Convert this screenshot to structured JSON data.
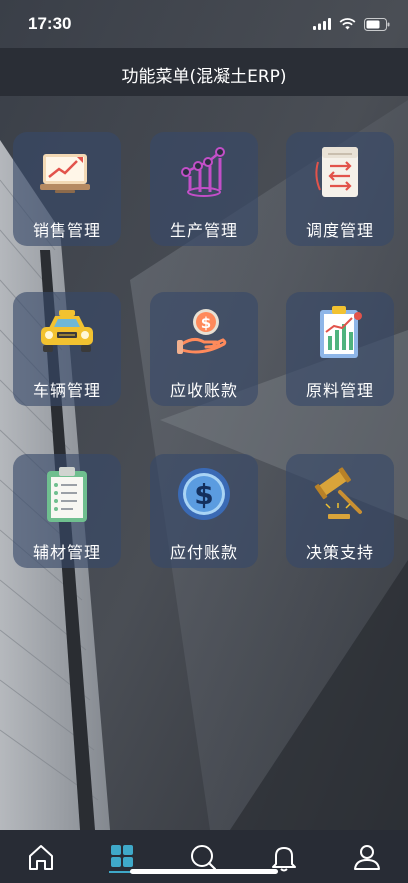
{
  "status_bar": {
    "time": "17:30",
    "icons": [
      "signal-icon",
      "wifi-icon",
      "battery-icon"
    ]
  },
  "header": {
    "title": "功能菜单(混凝土ERP)"
  },
  "menu": {
    "items": [
      {
        "label": "销售管理",
        "icon": "sales-chart-icon"
      },
      {
        "label": "生产管理",
        "icon": "production-graph-icon"
      },
      {
        "label": "调度管理",
        "icon": "dispatch-document-icon"
      },
      {
        "label": "车辆管理",
        "icon": "taxi-vehicle-icon"
      },
      {
        "label": "应收账款",
        "icon": "receivable-money-icon"
      },
      {
        "label": "原料管理",
        "icon": "material-clipboard-icon"
      },
      {
        "label": "辅材管理",
        "icon": "auxiliary-checklist-icon"
      },
      {
        "label": "应付账款",
        "icon": "payable-dollar-icon"
      },
      {
        "label": "决策支持",
        "icon": "gavel-decision-icon"
      }
    ]
  },
  "bottom_nav": {
    "items": [
      {
        "name": "home",
        "icon": "home-icon"
      },
      {
        "name": "menu",
        "icon": "grid-menu-icon",
        "active": true
      },
      {
        "name": "search",
        "icon": "search-icon"
      },
      {
        "name": "notifications",
        "icon": "bell-icon"
      },
      {
        "name": "profile",
        "icon": "user-icon"
      }
    ]
  },
  "colors": {
    "tile_bg": "#374869",
    "header_bg": "#2a2e36",
    "nav_bg": "#282c35",
    "text": "#ffffff",
    "active_accent": "#3fa9c9"
  }
}
